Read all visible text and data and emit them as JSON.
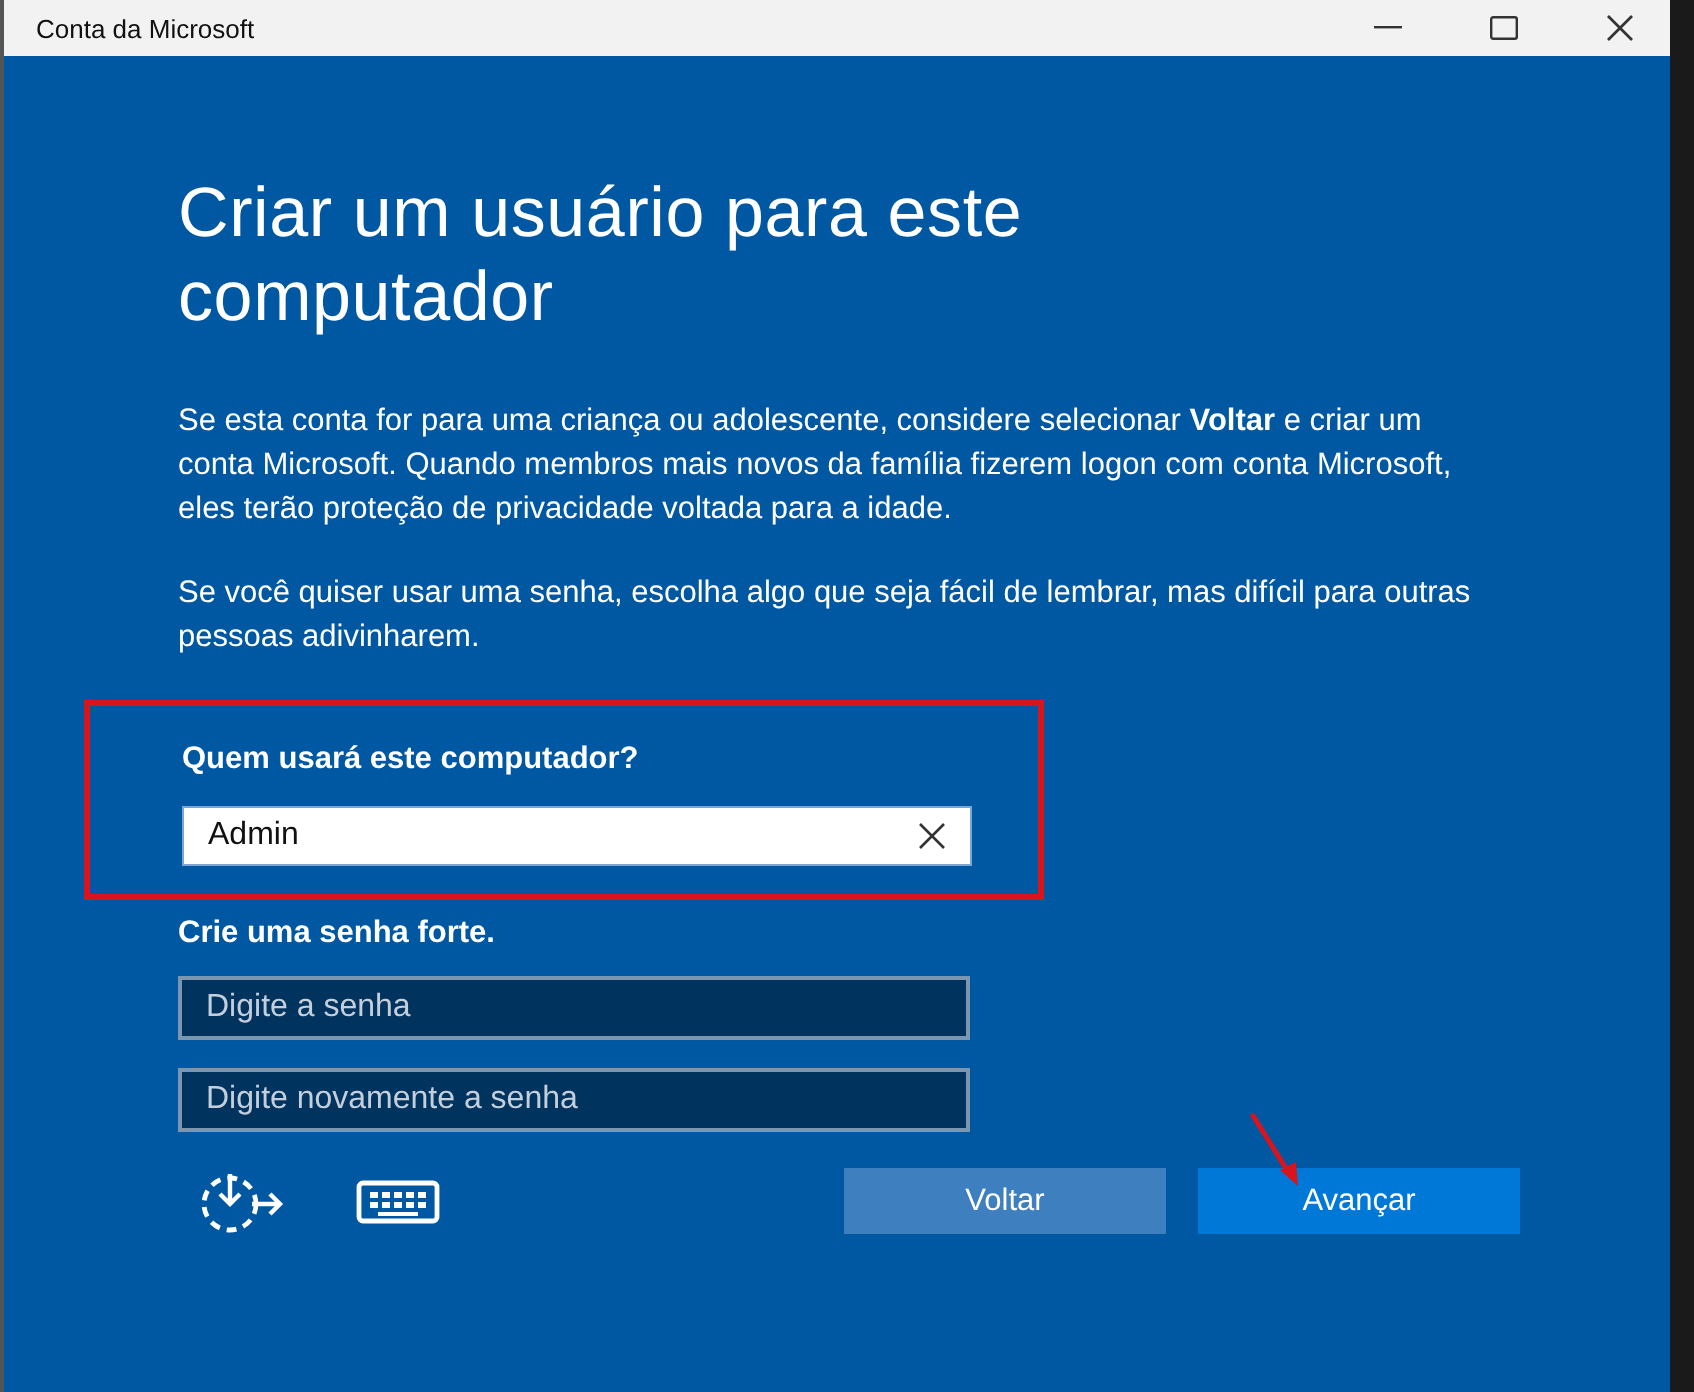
{
  "window": {
    "title": "Conta da Microsoft"
  },
  "heading": "Criar um usuário para este computador",
  "paragraphs": [
    "Se esta conta for para uma criança ou adolescente, considere selecionar **Voltar** e criar um conta Microsoft. Quando membros mais novos da família fizerem logon com conta Microsoft, eles terão proteção de privacidade voltada para a idade.",
    "Se você quiser usar uma senha, escolha algo que seja fácil de lembrar, mas difícil para outras pessoas adivinharem."
  ],
  "name_field": {
    "label": "Quem usará este computador?",
    "value": "Admin"
  },
  "password": {
    "label": "Crie uma senha forte.",
    "fields": [
      {
        "placeholder": "Digite a senha"
      },
      {
        "placeholder": "Digite novamente a senha"
      }
    ]
  },
  "buttons": [
    {
      "label": "Voltar",
      "kind": "secondary"
    },
    {
      "label": "Avançar",
      "kind": "primary"
    }
  ]
}
